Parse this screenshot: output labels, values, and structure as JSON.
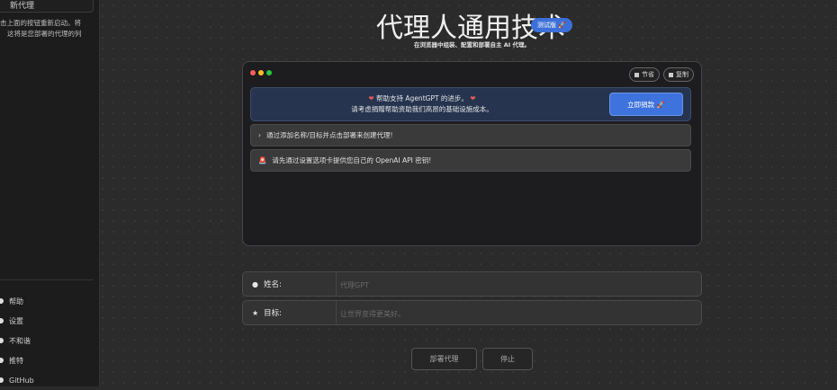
{
  "sidebar": {
    "agent_item": "新代理",
    "hint_line1": "击上面的按钮重新启动。将",
    "hint_line2": "这将是您部署的代理的列",
    "links": [
      {
        "label": "帮助",
        "icon": "help-icon"
      },
      {
        "label": "设置",
        "icon": "gear-icon"
      },
      {
        "label": "不和谐",
        "icon": "discord-icon"
      },
      {
        "label": "推特",
        "icon": "twitter-icon"
      },
      {
        "label": "GitHub",
        "icon": "github-icon"
      }
    ]
  },
  "header": {
    "title": "代理人通用技术",
    "beta_badge": "测试版 🚀",
    "subtitle": "在浏览器中组装、配置和部署自主 AI 代理。"
  },
  "panel": {
    "buttons": {
      "image": "节省",
      "copy": "复制"
    },
    "donate": {
      "line1": "帮助支持 AgentGPT 的进步。",
      "line2": "请考虑捐赠帮助资助我们高昂的基础设施成本。",
      "button": "立即捐款 🚀"
    },
    "messages": [
      {
        "icon": "›",
        "text": "通过添加名称/目标并点击部署来创建代理!"
      },
      {
        "icon": "🚨",
        "text": "请先通过设置选项卡提供您自己的 OpenAI API 密钥!"
      }
    ]
  },
  "form": {
    "name_label": "姓名:",
    "name_placeholder": "代理GPT",
    "goal_label": "目标:",
    "goal_placeholder": "让世界变得更美好。"
  },
  "actions": {
    "deploy": "部署代理",
    "stop": "停止"
  },
  "colors": {
    "accent": "#3e73de",
    "panel_bg": "#1d1d1f",
    "page_bg": "#2b2b2b"
  }
}
